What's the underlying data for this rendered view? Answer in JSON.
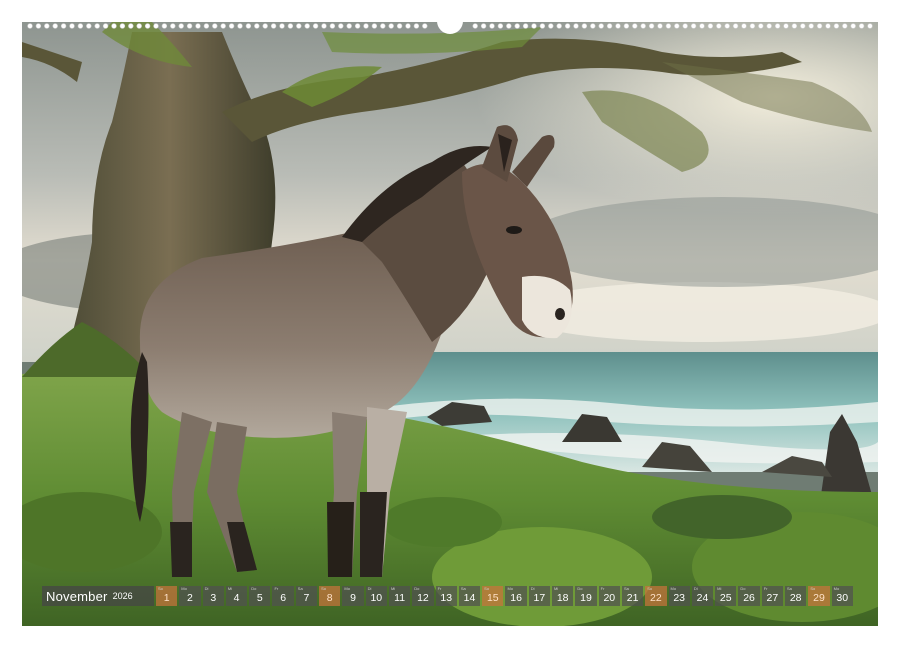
{
  "calendar": {
    "month": "November",
    "year": "2026",
    "days": [
      {
        "n": "1",
        "w": "So",
        "we": true
      },
      {
        "n": "2",
        "w": "Mo",
        "we": false
      },
      {
        "n": "3",
        "w": "Di",
        "we": false
      },
      {
        "n": "4",
        "w": "Mi",
        "we": false
      },
      {
        "n": "5",
        "w": "Do",
        "we": false
      },
      {
        "n": "6",
        "w": "Fr",
        "we": false
      },
      {
        "n": "7",
        "w": "Sa",
        "we": false
      },
      {
        "n": "8",
        "w": "So",
        "we": true
      },
      {
        "n": "9",
        "w": "Mo",
        "we": false
      },
      {
        "n": "10",
        "w": "Di",
        "we": false
      },
      {
        "n": "11",
        "w": "Mi",
        "we": false
      },
      {
        "n": "12",
        "w": "Do",
        "we": false
      },
      {
        "n": "13",
        "w": "Fr",
        "we": false
      },
      {
        "n": "14",
        "w": "Sa",
        "we": false
      },
      {
        "n": "15",
        "w": "So",
        "we": true
      },
      {
        "n": "16",
        "w": "Mo",
        "we": false
      },
      {
        "n": "17",
        "w": "Di",
        "we": false
      },
      {
        "n": "18",
        "w": "Mi",
        "we": false
      },
      {
        "n": "19",
        "w": "Do",
        "we": false
      },
      {
        "n": "20",
        "w": "Fr",
        "we": false
      },
      {
        "n": "21",
        "w": "Sa",
        "we": false
      },
      {
        "n": "22",
        "w": "So",
        "we": true
      },
      {
        "n": "23",
        "w": "Mo",
        "we": false
      },
      {
        "n": "24",
        "w": "Di",
        "we": false
      },
      {
        "n": "25",
        "w": "Mi",
        "we": false
      },
      {
        "n": "26",
        "w": "Do",
        "we": false
      },
      {
        "n": "27",
        "w": "Fr",
        "we": false
      },
      {
        "n": "28",
        "w": "Sa",
        "we": false
      },
      {
        "n": "29",
        "w": "So",
        "we": true
      },
      {
        "n": "30",
        "w": "Mo",
        "we": false
      }
    ]
  },
  "colors": {
    "day_cell": "#505050",
    "weekend_cell": "#c8733c",
    "grass": "#6e9a3e",
    "sea": "#7fb5b2"
  }
}
